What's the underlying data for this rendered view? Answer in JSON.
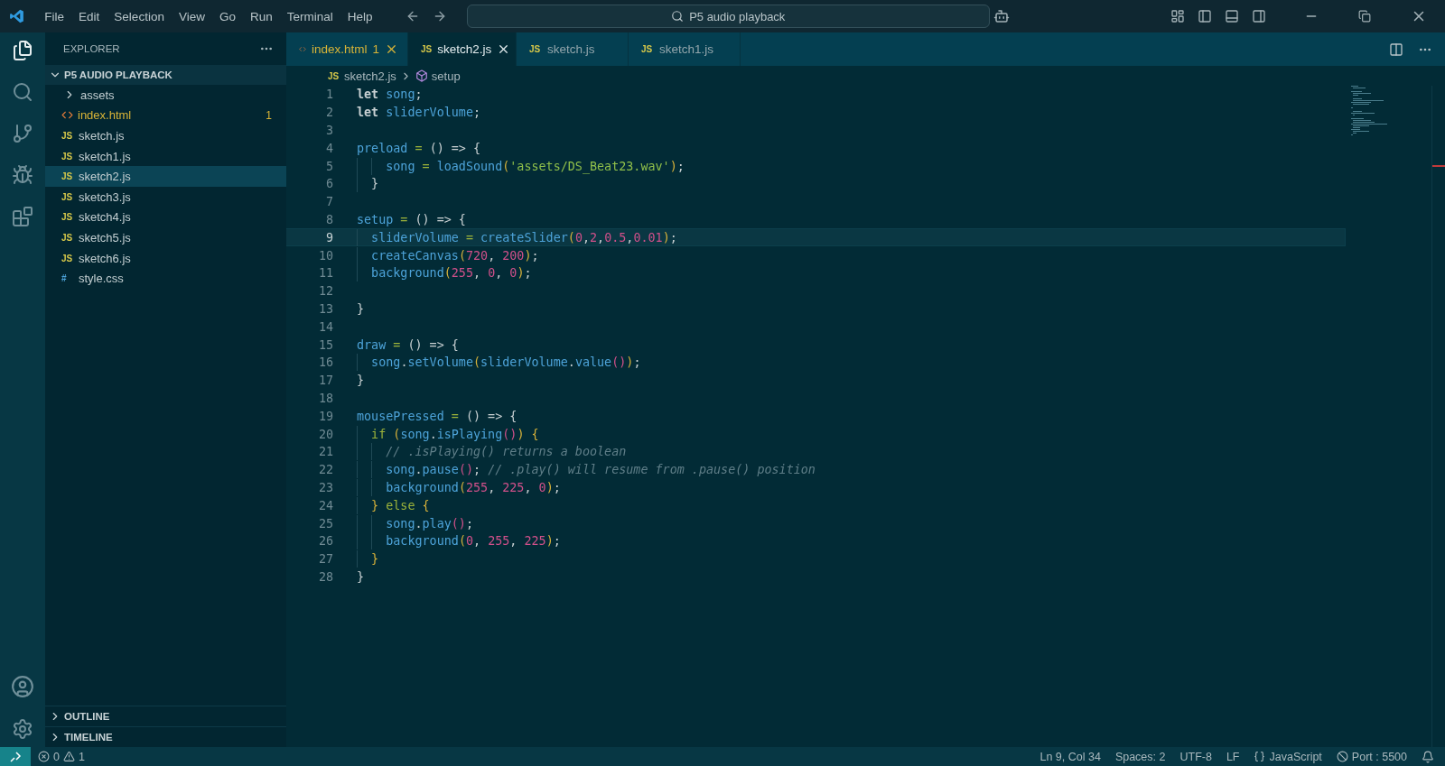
{
  "title_bar": {
    "menu": [
      "File",
      "Edit",
      "Selection",
      "View",
      "Go",
      "Run",
      "Terminal",
      "Help"
    ],
    "search": "P5 audio playback"
  },
  "sidebar": {
    "title": "EXPLORER",
    "root": {
      "label": "P5 AUDIO PLAYBACK",
      "expanded": true,
      "children": [
        {
          "label": "assets",
          "kind": "folder",
          "expanded": false,
          "warning": false,
          "selected": false
        },
        {
          "label": "index.html",
          "kind": "html",
          "badge": "1",
          "warning": true,
          "selected": false
        },
        {
          "label": "sketch.js",
          "kind": "js",
          "icon_label": "JS",
          "warning": false,
          "selected": false
        },
        {
          "label": "sketch1.js",
          "kind": "js",
          "icon_label": "JS",
          "warning": false,
          "selected": false
        },
        {
          "label": "sketch2.js",
          "kind": "js",
          "icon_label": "JS",
          "warning": false,
          "selected": true
        },
        {
          "label": "sketch3.js",
          "kind": "js",
          "icon_label": "JS",
          "warning": false,
          "selected": false
        },
        {
          "label": "sketch4.js",
          "kind": "js",
          "icon_label": "JS",
          "warning": false,
          "selected": false
        },
        {
          "label": "sketch5.js",
          "kind": "js",
          "icon_label": "JS",
          "warning": false,
          "selected": false
        },
        {
          "label": "sketch6.js",
          "kind": "js",
          "icon_label": "JS",
          "warning": false,
          "selected": false
        },
        {
          "label": "style.css",
          "kind": "css",
          "icon_label": "#",
          "warning": false,
          "selected": false
        }
      ]
    },
    "panels": [
      {
        "label": "OUTLINE",
        "expanded": false
      },
      {
        "label": "TIMELINE",
        "expanded": false
      }
    ]
  },
  "tabs": [
    {
      "label": "index.html",
      "kind": "html",
      "badge": "1",
      "warning": true,
      "selected": false,
      "close_visible": true
    },
    {
      "label": "sketch2.js",
      "kind": "js",
      "icon_label": "JS",
      "warning": false,
      "selected": true,
      "close_visible": true
    },
    {
      "label": "sketch.js",
      "kind": "js",
      "icon_label": "JS",
      "warning": false,
      "selected": false,
      "close_visible": false
    },
    {
      "label": "sketch1.js",
      "kind": "js",
      "icon_label": "JS",
      "warning": false,
      "selected": false,
      "close_visible": false
    }
  ],
  "breadcrumb": {
    "file": "sketch2.js",
    "icon_label": "JS",
    "symbol": "setup"
  },
  "editor": {
    "lines": [
      {
        "number": "1",
        "active": false,
        "tokens": [
          {
            "kind": "kw",
            "text": "let "
          },
          {
            "kind": "var",
            "text": "song"
          },
          {
            "kind": "punc",
            "text": ";"
          }
        ]
      },
      {
        "number": "2",
        "active": false,
        "tokens": [
          {
            "kind": "kw",
            "text": "let "
          },
          {
            "kind": "var",
            "text": "sliderVolume"
          },
          {
            "kind": "punc",
            "text": ";"
          }
        ]
      },
      {
        "number": "3",
        "active": false
      },
      {
        "number": "4",
        "active": false,
        "tokens": [
          {
            "kind": "var",
            "text": "preload"
          },
          {
            "kind": "op",
            "text": " = "
          },
          {
            "kind": "punc",
            "text": "() => {"
          }
        ]
      },
      {
        "number": "5",
        "active": false,
        "tokens": [
          {
            "kind": "var",
            "text": "    song"
          },
          {
            "kind": "op",
            "text": " = "
          },
          {
            "kind": "fn",
            "text": "loadSound"
          },
          {
            "kind": "p1",
            "text": "("
          },
          {
            "kind": "str",
            "text": "'assets/DS_Beat23.wav'"
          },
          {
            "kind": "p1",
            "text": ")"
          },
          {
            "kind": "punc",
            "text": ";"
          }
        ]
      },
      {
        "number": "6",
        "active": false,
        "tokens": [
          {
            "kind": "punc",
            "text": "  }"
          }
        ]
      },
      {
        "number": "7",
        "active": false
      },
      {
        "number": "8",
        "active": false,
        "tokens": [
          {
            "kind": "var",
            "text": "setup"
          },
          {
            "kind": "op",
            "text": " = "
          },
          {
            "kind": "punc",
            "text": "() => {"
          }
        ]
      },
      {
        "number": "9",
        "active": true,
        "tokens": [
          {
            "kind": "var",
            "text": "  sliderVolume"
          },
          {
            "kind": "op",
            "text": " = "
          },
          {
            "kind": "fn",
            "text": "createSlider"
          },
          {
            "kind": "p1",
            "text": "("
          },
          {
            "kind": "num",
            "text": "0"
          },
          {
            "kind": "punc",
            "text": ","
          },
          {
            "kind": "num",
            "text": "2"
          },
          {
            "kind": "punc",
            "text": ","
          },
          {
            "kind": "num",
            "text": "0.5"
          },
          {
            "kind": "punc",
            "text": ","
          },
          {
            "kind": "num",
            "text": "0.01"
          },
          {
            "kind": "p1",
            "text": ")"
          },
          {
            "kind": "punc",
            "text": ";"
          }
        ]
      },
      {
        "number": "10",
        "active": false,
        "tokens": [
          {
            "kind": "fn",
            "text": "  createCanvas"
          },
          {
            "kind": "p1",
            "text": "("
          },
          {
            "kind": "num",
            "text": "720"
          },
          {
            "kind": "punc",
            "text": ", "
          },
          {
            "kind": "num",
            "text": "200"
          },
          {
            "kind": "p1",
            "text": ")"
          },
          {
            "kind": "punc",
            "text": ";"
          }
        ]
      },
      {
        "number": "11",
        "active": false,
        "tokens": [
          {
            "kind": "fn",
            "text": "  background"
          },
          {
            "kind": "p1",
            "text": "("
          },
          {
            "kind": "num",
            "text": "255"
          },
          {
            "kind": "punc",
            "text": ", "
          },
          {
            "kind": "num",
            "text": "0"
          },
          {
            "kind": "punc",
            "text": ", "
          },
          {
            "kind": "num",
            "text": "0"
          },
          {
            "kind": "p1",
            "text": ")"
          },
          {
            "kind": "punc",
            "text": ";"
          }
        ]
      },
      {
        "number": "12",
        "active": false
      },
      {
        "number": "13",
        "active": false,
        "tokens": [
          {
            "kind": "punc",
            "text": "}"
          }
        ]
      },
      {
        "number": "14",
        "active": false
      },
      {
        "number": "15",
        "active": false,
        "tokens": [
          {
            "kind": "var",
            "text": "draw"
          },
          {
            "kind": "op",
            "text": " = "
          },
          {
            "kind": "punc",
            "text": "() => {"
          }
        ]
      },
      {
        "number": "16",
        "active": false,
        "tokens": [
          {
            "kind": "var",
            "text": "  song"
          },
          {
            "kind": "punc",
            "text": "."
          },
          {
            "kind": "fn",
            "text": "setVolume"
          },
          {
            "kind": "p1",
            "text": "("
          },
          {
            "kind": "var",
            "text": "sliderVolume"
          },
          {
            "kind": "punc",
            "text": "."
          },
          {
            "kind": "fn",
            "text": "value"
          },
          {
            "kind": "p2",
            "text": "()"
          },
          {
            "kind": "p1",
            "text": ")"
          },
          {
            "kind": "punc",
            "text": ";"
          }
        ]
      },
      {
        "number": "17",
        "active": false,
        "tokens": [
          {
            "kind": "punc",
            "text": "}"
          }
        ]
      },
      {
        "number": "18",
        "active": false
      },
      {
        "number": "19",
        "active": false,
        "tokens": [
          {
            "kind": "var",
            "text": "mousePressed"
          },
          {
            "kind": "op",
            "text": " = "
          },
          {
            "kind": "punc",
            "text": "() => {"
          }
        ]
      },
      {
        "number": "20",
        "active": false,
        "tokens": [
          {
            "kind": "ctl",
            "text": "  if "
          },
          {
            "kind": "p1",
            "text": "("
          },
          {
            "kind": "var",
            "text": "song"
          },
          {
            "kind": "punc",
            "text": "."
          },
          {
            "kind": "fn",
            "text": "isPlaying"
          },
          {
            "kind": "p2",
            "text": "()"
          },
          {
            "kind": "p1",
            "text": ")"
          },
          {
            "kind": "p1",
            "text": " {"
          }
        ]
      },
      {
        "number": "21",
        "active": false,
        "tokens": [
          {
            "kind": "cmt",
            "text": "    // .isPlaying() returns a boolean"
          }
        ]
      },
      {
        "number": "22",
        "active": false,
        "tokens": [
          {
            "kind": "var",
            "text": "    song"
          },
          {
            "kind": "punc",
            "text": "."
          },
          {
            "kind": "fn",
            "text": "pause"
          },
          {
            "kind": "p2",
            "text": "()"
          },
          {
            "kind": "punc",
            "text": "; "
          },
          {
            "kind": "cmt",
            "text": "// .play() will resume from .pause() position"
          }
        ]
      },
      {
        "number": "23",
        "active": false,
        "tokens": [
          {
            "kind": "fn",
            "text": "    background"
          },
          {
            "kind": "p1",
            "text": "("
          },
          {
            "kind": "num",
            "text": "255"
          },
          {
            "kind": "punc",
            "text": ", "
          },
          {
            "kind": "num",
            "text": "225"
          },
          {
            "kind": "punc",
            "text": ", "
          },
          {
            "kind": "num",
            "text": "0"
          },
          {
            "kind": "p1",
            "text": ")"
          },
          {
            "kind": "punc",
            "text": ";"
          }
        ]
      },
      {
        "number": "24",
        "active": false,
        "tokens": [
          {
            "kind": "p1",
            "text": "  }"
          },
          {
            "kind": "ctl",
            "text": " else "
          },
          {
            "kind": "p1",
            "text": "{"
          }
        ]
      },
      {
        "number": "25",
        "active": false,
        "tokens": [
          {
            "kind": "var",
            "text": "    song"
          },
          {
            "kind": "punc",
            "text": "."
          },
          {
            "kind": "fn",
            "text": "play"
          },
          {
            "kind": "p2",
            "text": "()"
          },
          {
            "kind": "punc",
            "text": ";"
          }
        ]
      },
      {
        "number": "26",
        "active": false,
        "tokens": [
          {
            "kind": "fn",
            "text": "    background"
          },
          {
            "kind": "p1",
            "text": "("
          },
          {
            "kind": "num",
            "text": "0"
          },
          {
            "kind": "punc",
            "text": ", "
          },
          {
            "kind": "num",
            "text": "255"
          },
          {
            "kind": "punc",
            "text": ", "
          },
          {
            "kind": "num",
            "text": "225"
          },
          {
            "kind": "p1",
            "text": ")"
          },
          {
            "kind": "punc",
            "text": ";"
          }
        ]
      },
      {
        "number": "27",
        "active": false,
        "tokens": [
          {
            "kind": "p1",
            "text": "  }"
          }
        ]
      },
      {
        "number": "28",
        "active": false,
        "tokens": [
          {
            "kind": "punc",
            "text": "}"
          }
        ]
      }
    ]
  },
  "status_bar": {
    "errors": "0",
    "warnings": "1",
    "position": "Ln 9, Col 34",
    "indent": "Spaces: 2",
    "encoding": "UTF-8",
    "eol": "LF",
    "language": "JavaScript",
    "port": "Port : 5500"
  }
}
